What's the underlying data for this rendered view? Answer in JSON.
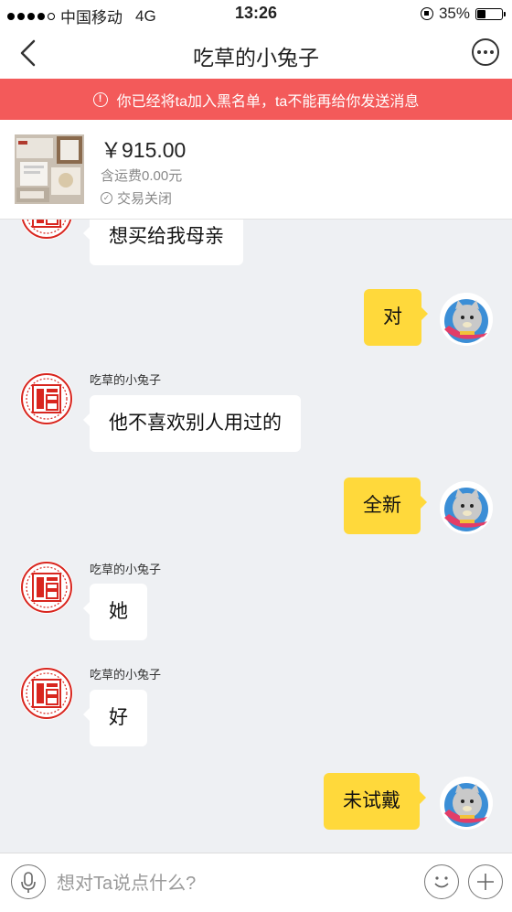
{
  "status_bar": {
    "carrier": "中国移动",
    "network": "4G",
    "time": "13:26",
    "battery": "35%",
    "battery_level": 0.35,
    "signal_bars_filled": 4,
    "signal_bars_total": 5
  },
  "nav": {
    "title": "吃草的小兔子"
  },
  "banner": {
    "text": "你已经将ta加入黑名单，ta不能再给你发送消息"
  },
  "product": {
    "price": "￥915.00",
    "shipping": "含运费0.00元",
    "deal_status": "交易关闭"
  },
  "messages": [
    {
      "side": "left",
      "text": "想买给我母亲",
      "nickname": ""
    },
    {
      "side": "right",
      "text": "对"
    },
    {
      "side": "left",
      "nickname": "吃草的小兔子",
      "text": "他不喜欢别人用过的"
    },
    {
      "side": "right",
      "text": "全新"
    },
    {
      "side": "left",
      "nickname": "吃草的小兔子",
      "text": "她"
    },
    {
      "side": "left",
      "nickname": "吃草的小兔子",
      "text": "好"
    },
    {
      "side": "right",
      "text": "未试戴"
    }
  ],
  "input": {
    "placeholder": "想对Ta说点什么?"
  },
  "colors": {
    "banner": "#f35a5a",
    "own_bubble": "#ffd93b",
    "chat_bg": "#eef0f3",
    "seal_red": "#d8261f"
  },
  "icons": {
    "back": "chevron-left-icon",
    "more": "more-dots-icon",
    "info": "info-icon",
    "check": "check-circle-icon",
    "mic": "microphone-icon",
    "emoji": "smiley-icon",
    "plus": "plus-icon"
  }
}
